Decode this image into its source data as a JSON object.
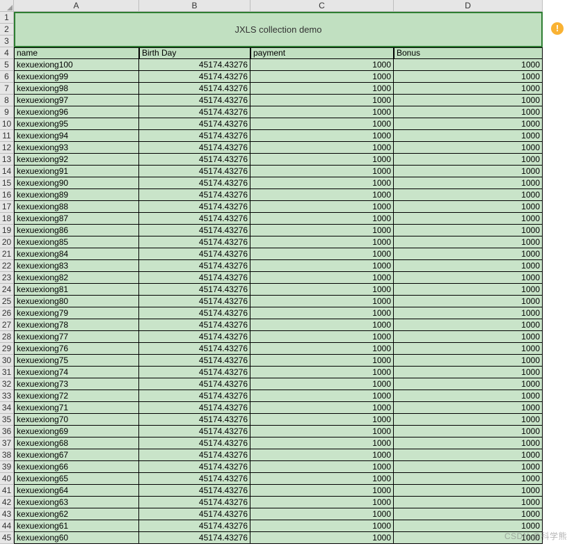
{
  "columns": [
    "A",
    "B",
    "C",
    "D"
  ],
  "title": "JXLS collection demo",
  "headers": {
    "name": "name",
    "birth": "Birth Day",
    "payment": "payment",
    "bonus": "Bonus"
  },
  "firstDataRow": 5,
  "lastDataRow": 45,
  "birthValue": "45174.43276",
  "paymentValue": "1000",
  "bonusValue": "1000",
  "rows": [
    {
      "name": "kexuexiong100"
    },
    {
      "name": "kexuexiong99"
    },
    {
      "name": "kexuexiong98"
    },
    {
      "name": "kexuexiong97"
    },
    {
      "name": "kexuexiong96"
    },
    {
      "name": "kexuexiong95"
    },
    {
      "name": "kexuexiong94"
    },
    {
      "name": "kexuexiong93"
    },
    {
      "name": "kexuexiong92"
    },
    {
      "name": "kexuexiong91"
    },
    {
      "name": "kexuexiong90"
    },
    {
      "name": "kexuexiong89"
    },
    {
      "name": "kexuexiong88"
    },
    {
      "name": "kexuexiong87"
    },
    {
      "name": "kexuexiong86"
    },
    {
      "name": "kexuexiong85"
    },
    {
      "name": "kexuexiong84"
    },
    {
      "name": "kexuexiong83"
    },
    {
      "name": "kexuexiong82"
    },
    {
      "name": "kexuexiong81"
    },
    {
      "name": "kexuexiong80"
    },
    {
      "name": "kexuexiong79"
    },
    {
      "name": "kexuexiong78"
    },
    {
      "name": "kexuexiong77"
    },
    {
      "name": "kexuexiong76"
    },
    {
      "name": "kexuexiong75"
    },
    {
      "name": "kexuexiong74"
    },
    {
      "name": "kexuexiong73"
    },
    {
      "name": "kexuexiong72"
    },
    {
      "name": "kexuexiong71"
    },
    {
      "name": "kexuexiong70"
    },
    {
      "name": "kexuexiong69"
    },
    {
      "name": "kexuexiong68"
    },
    {
      "name": "kexuexiong67"
    },
    {
      "name": "kexuexiong66"
    },
    {
      "name": "kexuexiong65"
    },
    {
      "name": "kexuexiong64"
    },
    {
      "name": "kexuexiong63"
    },
    {
      "name": "kexuexiong62"
    },
    {
      "name": "kexuexiong61"
    },
    {
      "name": "kexuexiong60"
    }
  ],
  "warnGlyph": "!",
  "watermark": "CSDN @科学熊"
}
